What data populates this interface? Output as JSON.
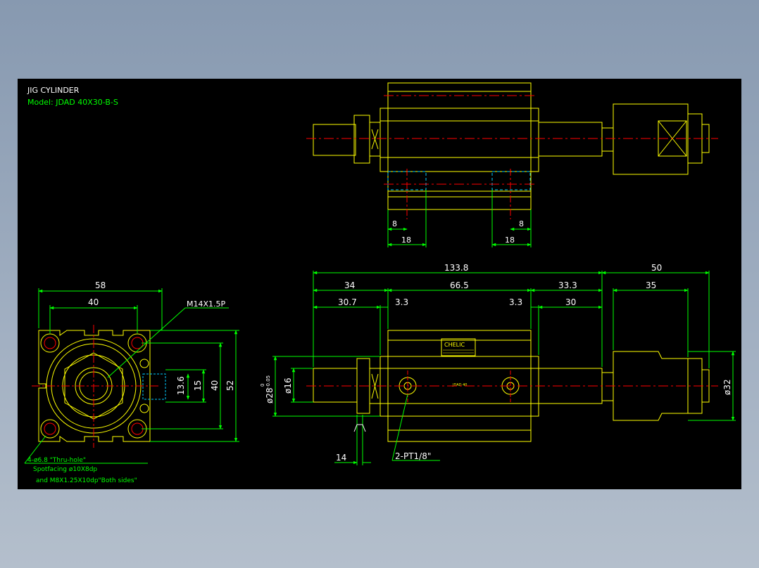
{
  "title_block": {
    "title": "JIG CYLINDER",
    "model": "Model: JDAD 40X30-B-S"
  },
  "front_view": {
    "dims": {
      "width_58": "58",
      "width_40": "40",
      "height_52": "52",
      "height_40": "40",
      "port_15": "15",
      "port_13_6": "13.6"
    },
    "thread_callout": "M14X1.5P",
    "hole_note_1": "4-ø6.8 \"Thru-hole\"",
    "hole_note_2": "Spotfacing  ø10X8dp",
    "hole_note_3": "and M8X1.25X10dp\"Both sides\""
  },
  "top_view": {
    "dims": {
      "left_8": "8",
      "left_18": "18",
      "right_18": "18",
      "right_8": "8"
    }
  },
  "side_view": {
    "dims": {
      "overall": "133.8",
      "rod_50": "50",
      "d34": "34",
      "d66_5": "66.5",
      "d33_3": "33.3",
      "d35": "35",
      "d30_7": "30.7",
      "d3_3_left": "3.3",
      "d3_3_right": "3.3",
      "d30": "30",
      "d14": "14",
      "dia16": "ø16",
      "dia28": "ø28",
      "tol_upper": "0",
      "tol_lower": "-0.05",
      "dia32": "ø32"
    },
    "port_callout": "2-PT1/8\"",
    "brand_label": "CHELIC",
    "body_label": "JDAD 40"
  },
  "colors": {
    "outline": "#ffff00",
    "dimension": "#00ff00",
    "centerline": "#ff0000",
    "hidden": "#00ccff",
    "text": "#ffffff"
  }
}
